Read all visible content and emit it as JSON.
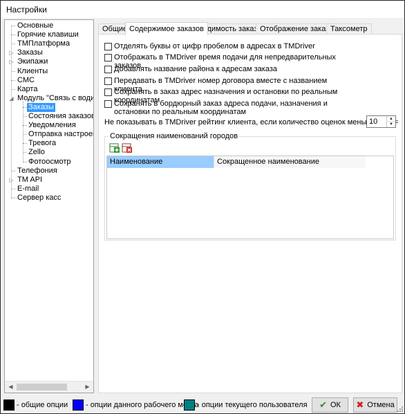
{
  "window": {
    "title": "Настройки"
  },
  "tree": {
    "items": [
      {
        "label": "Основные",
        "expandable": false
      },
      {
        "label": "Горячие клавиши",
        "expandable": false
      },
      {
        "label": "TMПлатформа",
        "expandable": false
      },
      {
        "label": "Заказы",
        "expandable": true
      },
      {
        "label": "Экипажи",
        "expandable": true
      },
      {
        "label": "Клиенты",
        "expandable": false
      },
      {
        "label": "СМС",
        "expandable": false
      },
      {
        "label": "Карта",
        "expandable": false
      },
      {
        "label": "Модуль \"Связь с водителями\"",
        "expandable": true,
        "expanded": true
      },
      {
        "label": "Заказы",
        "child": true,
        "selected": true
      },
      {
        "label": "Состояния заказов",
        "child": true
      },
      {
        "label": "Уведомления",
        "child": true
      },
      {
        "label": "Отправка настроек в TMDriver",
        "child": true
      },
      {
        "label": "Тревога",
        "child": true
      },
      {
        "label": "Zello",
        "child": true
      },
      {
        "label": "Фотоосмотр",
        "child": true
      },
      {
        "label": "Телефония",
        "expandable": false
      },
      {
        "label": "TM API",
        "expandable": true
      },
      {
        "label": "E-mail",
        "expandable": false
      },
      {
        "label": "Сервер касс",
        "expandable": false
      }
    ]
  },
  "tabs": [
    {
      "label": "Общие",
      "active": false
    },
    {
      "label": "Содержимое заказов",
      "active": true
    },
    {
      "label": "Видимость заказов",
      "active": false
    },
    {
      "label": "Отображение заказов",
      "active": false
    },
    {
      "label": "Таксометр",
      "active": false
    }
  ],
  "options": [
    {
      "label": "Отделять буквы от цифр пробелом в адресах в TMDriver",
      "checked": false
    },
    {
      "label": "Отображать в TMDriver время подачи для непредварительных заказов",
      "checked": false
    },
    {
      "label": "Добавлять название района к адресам заказа",
      "checked": false
    },
    {
      "label": "Передавать в TMDriver номер договора вместе с названием клиента",
      "checked": false
    },
    {
      "label": "Сохранять в заказ адрес назначения и остановки по реальным координатам",
      "checked": false
    },
    {
      "label": "Сохранять в бордюрный заказ адреса подачи, назначения и остановки по реальным координатам",
      "checked": false
    }
  ],
  "rating": {
    "label": "Не показывать в TMDriver рейтинг клиента, если количество оценок меньше X, X =",
    "value": "10"
  },
  "city_abbreviations": {
    "title": "Сокращения наименований городов",
    "add_icon": "add-row-icon",
    "delete_icon": "delete-row-icon",
    "columns": [
      "Наименование",
      "Сокращенное наименование"
    ],
    "rows": []
  },
  "legend": [
    {
      "color": "#000000",
      "label": "- общие опции"
    },
    {
      "color": "#0000ff",
      "label": "- опции данного рабочего места"
    },
    {
      "color": "#008080",
      "label": "- опции текущего пользователя"
    }
  ],
  "buttons": {
    "ok": {
      "label": "ОК",
      "icon": "check-icon",
      "color": "#2e8b2e"
    },
    "cancel": {
      "label": "Отмена",
      "icon": "cross-icon",
      "color": "#d02020"
    }
  }
}
